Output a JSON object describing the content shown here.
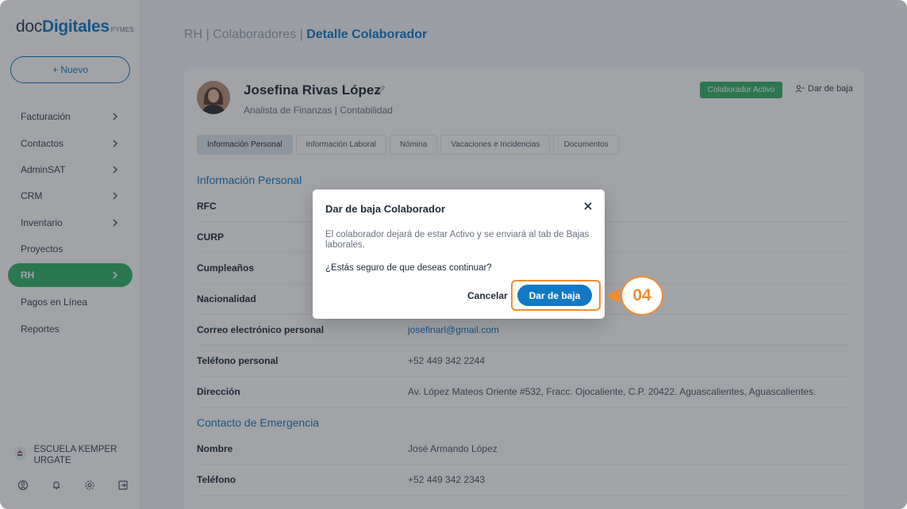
{
  "brand": {
    "doc": "doc",
    "digitales": "Digitales",
    "pymes": "PYMES"
  },
  "sidebar": {
    "new_button": "+ Nuevo",
    "items": [
      {
        "label": "Facturación",
        "chevron": true
      },
      {
        "label": "Contactos",
        "chevron": true
      },
      {
        "label": "AdminSAT",
        "chevron": true
      },
      {
        "label": "CRM",
        "chevron": true
      },
      {
        "label": "Inventario",
        "chevron": true
      },
      {
        "label": "Proyectos",
        "chevron": false
      },
      {
        "label": "RH",
        "chevron": true,
        "active": true
      },
      {
        "label": "Pagos en Línea",
        "chevron": false
      },
      {
        "label": "Reportes",
        "chevron": false
      }
    ],
    "company": "ESCUELA KEMPER URGATE",
    "footer_icons": [
      "user-circle-icon",
      "bell-icon",
      "gear-icon",
      "logout-icon"
    ]
  },
  "breadcrumb": {
    "part1": "RH",
    "sep": "|",
    "part2": "Colaboradores",
    "current": "Detalle Colaborador"
  },
  "profile": {
    "name": "Josefina Rivas López",
    "position": "Analista de Finanzas",
    "separator": "|",
    "department": "Contabilidad",
    "status": "Colaborador Activo",
    "deactivate_link": "Dar de baja"
  },
  "tabs": [
    "Información Personal",
    "Información Laboral",
    "Nómina",
    "Vacaciones e Incidencias",
    "Documentos"
  ],
  "personal_section": {
    "title": "Información Personal",
    "rows": [
      {
        "label": "RFC",
        "value": ""
      },
      {
        "label": "CURP",
        "value": ""
      },
      {
        "label": "Cumpleaños",
        "value": ""
      },
      {
        "label": "Nacionalidad",
        "value": ""
      },
      {
        "label": "Correo electrónico personal",
        "value": "josefinarl@gmail.com"
      },
      {
        "label": "Teléfono personal",
        "value": "+52 449 342 2244"
      },
      {
        "label": "Dirección",
        "value": "Av. López Mateos Oriente #532, Fracc. Ojocaliente, C.P. 20422. Aguascalientes, Aguascalientes."
      }
    ]
  },
  "emergency_section": {
    "title": "Contacto de Emergencia",
    "rows": [
      {
        "label": "Nombre",
        "value": "José Armando López"
      },
      {
        "label": "Teléfono",
        "value": "+52 449 342 2343"
      }
    ]
  },
  "modal": {
    "title": "Dar de baja Colaborador",
    "message": "El colaborador dejará de estar Activo y se enviará al tab de Bajas laborales.",
    "question": "¿Estás seguro de que deseas continuar?",
    "cancel": "Cancelar",
    "confirm": "Dar de baja"
  },
  "step_marker": "04",
  "colors": {
    "accent": "#1279c4",
    "active_green": "#35b36a",
    "highlight_orange": "#f28c2f"
  }
}
